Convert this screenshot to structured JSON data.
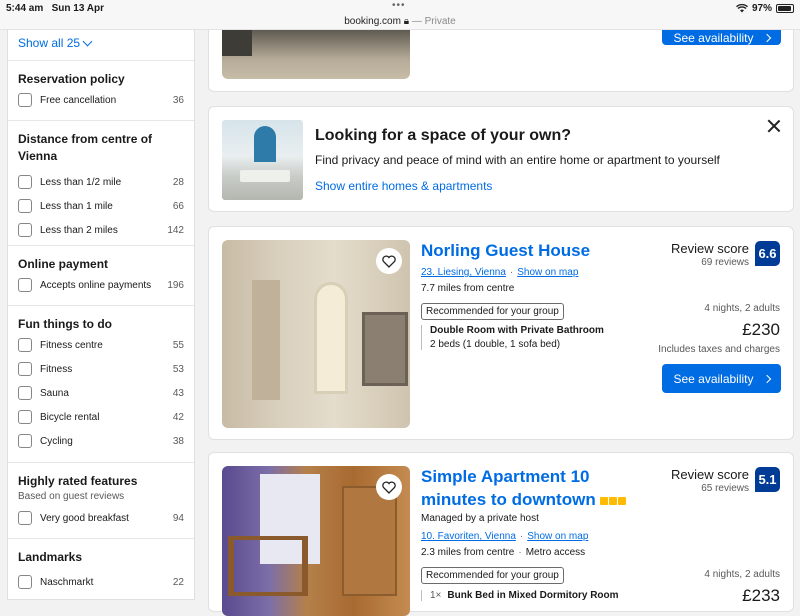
{
  "status_bar": {
    "time": "5:44 am",
    "date": "Sun 13 Apr",
    "dots": "•••",
    "domain": "booking.com",
    "private": "— Private",
    "battery": "97%"
  },
  "sidebar": {
    "show_all": "Show all 25",
    "sections": [
      {
        "title": "Reservation policy",
        "options": [
          {
            "label": "Free cancellation",
            "count": "36"
          }
        ]
      },
      {
        "title": "Distance from centre of Vienna",
        "options": [
          {
            "label": "Less than 1/2 mile",
            "count": "28"
          },
          {
            "label": "Less than 1 mile",
            "count": "66"
          },
          {
            "label": "Less than 2 miles",
            "count": "142"
          }
        ]
      },
      {
        "title": "Online payment",
        "options": [
          {
            "label": "Accepts online payments",
            "count": "196"
          }
        ]
      },
      {
        "title": "Fun things to do",
        "options": [
          {
            "label": "Fitness centre",
            "count": "55"
          },
          {
            "label": "Fitness",
            "count": "53"
          },
          {
            "label": "Sauna",
            "count": "43"
          },
          {
            "label": "Bicycle rental",
            "count": "42"
          },
          {
            "label": "Cycling",
            "count": "38"
          }
        ]
      },
      {
        "title": "Highly rated features",
        "subtitle": "Based on guest reviews",
        "options": [
          {
            "label": "Very good breakfast",
            "count": "94"
          }
        ]
      },
      {
        "title": "Landmarks",
        "options": [
          {
            "label": "Naschmarkt",
            "count": "22"
          }
        ]
      }
    ]
  },
  "top_card": {
    "button": "See availability"
  },
  "promo": {
    "title": "Looking for a space of your own?",
    "text": "Find privacy and peace of mind with an entire home or apartment to yourself",
    "link": "Show entire homes & apartments"
  },
  "properties": [
    {
      "name": "Norling Guest House",
      "district": "23. Liesing, Vienna",
      "show_on_map": "Show on map",
      "distance": "7.7 miles from centre",
      "recommended": "Recommended for your group",
      "room": "Double Room with Private Bathroom",
      "beds": "2 beds (1 double, 1 sofa bed)",
      "review_label": "Review score",
      "review_count": "69 reviews",
      "score": "6.6",
      "stay": "4 nights, 2 adults",
      "price": "£230",
      "taxes": "Includes taxes and charges",
      "button": "See availability"
    },
    {
      "name_line1": "Simple Apartment 10",
      "name_line2": "minutes to downtown",
      "stars": 3,
      "host": "Managed by a private host",
      "district": "10. Favoriten, Vienna",
      "show_on_map": "Show on map",
      "distance": "2.3 miles from centre",
      "metro": "Metro access",
      "recommended": "Recommended for your group",
      "room_qty": "1×",
      "room": "Bunk Bed in Mixed Dormitory Room",
      "review_label": "Review score",
      "review_count": "65 reviews",
      "score": "5.1",
      "stay": "4 nights, 2 adults",
      "price": "£233"
    }
  ],
  "colors": {
    "link": "#006ce4",
    "score_bg": "#003b95",
    "button": "#006ce4",
    "star": "#febb02"
  }
}
